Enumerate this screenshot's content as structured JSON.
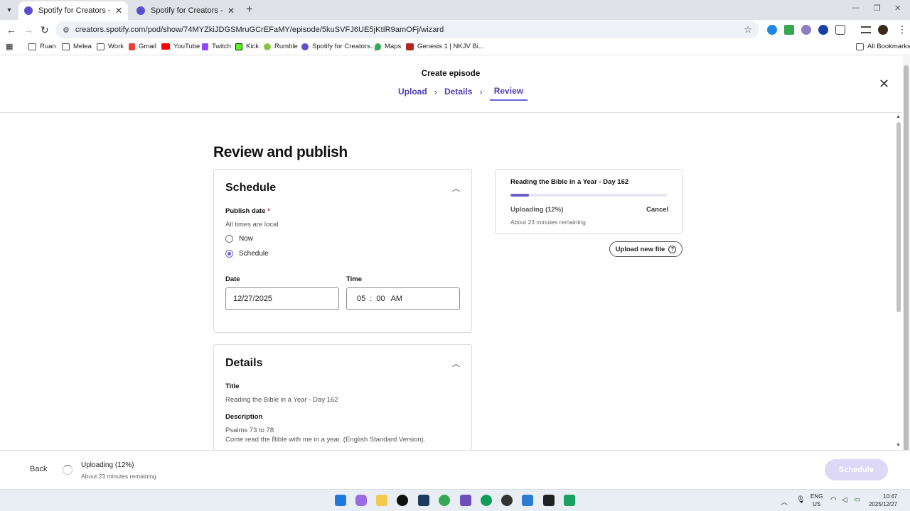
{
  "browser": {
    "tabs": [
      {
        "title": "Spotify for Creators - The easie",
        "active": true
      },
      {
        "title": "Spotify for Creators - The easie",
        "active": false
      }
    ],
    "url": "creators.spotify.com/pod/show/74MYZkiJDGSMruGCrEFaMY/episode/5kuSVFJ6UE5jKtIR9amOFj/wizard",
    "bookmarks": [
      {
        "label": "Ruan",
        "icon": "folder-icon"
      },
      {
        "label": "Melea",
        "icon": "folder-icon"
      },
      {
        "label": "Work",
        "icon": "folder-icon"
      },
      {
        "label": "Gmail",
        "icon": "gmail-icon"
      },
      {
        "label": "YouTube",
        "icon": "youtube-icon"
      },
      {
        "label": "Twitch",
        "icon": "twitch-icon"
      },
      {
        "label": "Kick",
        "icon": "kick-icon"
      },
      {
        "label": "Rumble",
        "icon": "rumble-icon"
      },
      {
        "label": "Spotify for Creators...",
        "icon": "spotify-creators-icon"
      },
      {
        "label": "Maps",
        "icon": "maps-icon"
      },
      {
        "label": "Genesis 1 | NKJV Bi...",
        "icon": "bible-icon"
      }
    ],
    "all_bookmarks": "All Bookmarks"
  },
  "wizard": {
    "title": "Create episode",
    "steps": [
      "Upload",
      "Details",
      "Review"
    ],
    "current_step": "Review"
  },
  "page_title": "Review and publish",
  "schedule": {
    "heading": "Schedule",
    "publish_label": "Publish date",
    "required_mark": "*",
    "timezone_note": "All times are local",
    "options": [
      "Now",
      "Schedule"
    ],
    "selected_option": "Schedule",
    "date_label": "Date",
    "date_value": "12/27/2025",
    "time_label": "Time",
    "time_hour": "05",
    "time_sep": ":",
    "time_minute": "00",
    "time_period": "AM"
  },
  "details": {
    "heading": "Details",
    "title_label": "Title",
    "title_value": "Reading the Bible in a Year - Day 162",
    "description_label": "Description",
    "description_line1": "Psalms 73 to 78",
    "description_line2": "Come read the Bible with me in a year. (English Standard Version)."
  },
  "upload": {
    "file_title": "Reading the Bible in a Year - Day 162",
    "status": "Uploading (12%)",
    "progress": 0.12,
    "remaining": "About 23 minutes remaining",
    "cancel_label": "Cancel",
    "upload_new_label": "Upload new file",
    "help_glyph": "?"
  },
  "footer": {
    "back_label": "Back",
    "status": "Uploading (12%)",
    "remaining": "About 23 minutes remaining",
    "schedule_label": "Schedule"
  },
  "taskbar": {
    "lang_top": "ENG",
    "lang_bottom": "US",
    "time": "10:47",
    "date": "2025/12/27"
  },
  "colors": {
    "accent": "#6b5fd3",
    "step_link": "#4b3fb5",
    "disabled_button": "#ddd8f6"
  }
}
